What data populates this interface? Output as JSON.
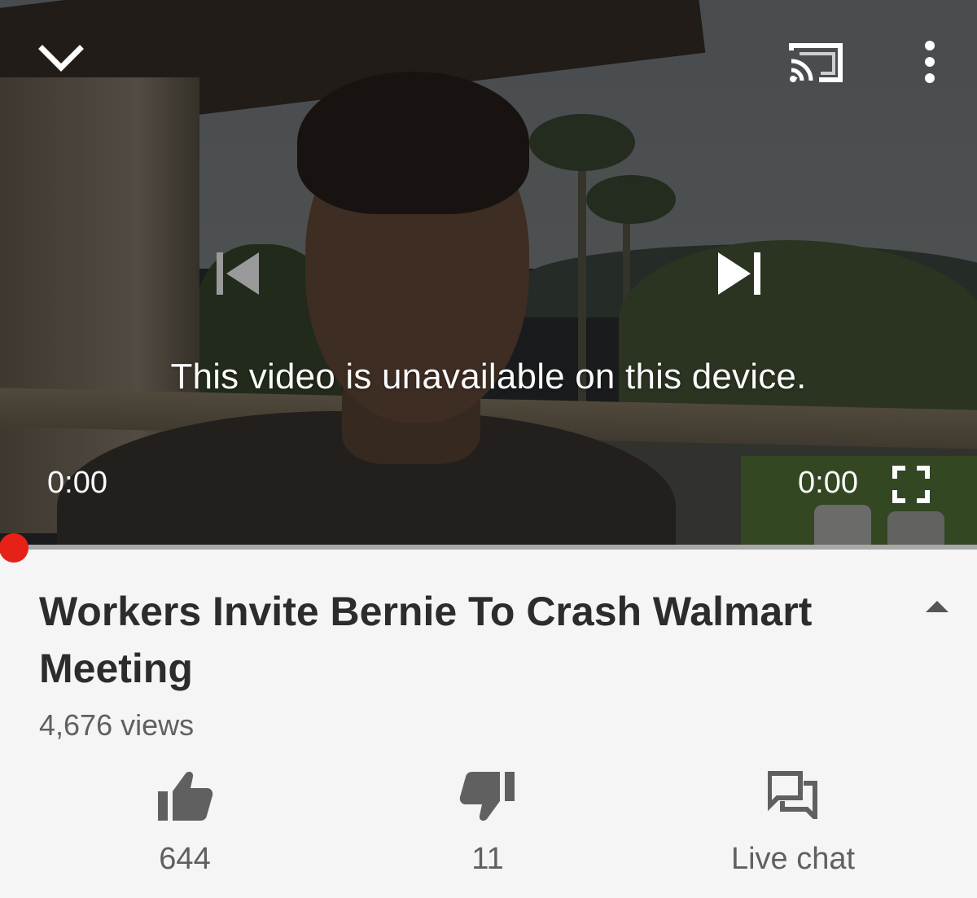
{
  "player": {
    "message": "This video is unavailable on this device.",
    "current_time": "0:00",
    "duration": "0:00",
    "progress": 0,
    "accent_color": "#e62117",
    "icons": {
      "collapse": "chevron-down-icon",
      "cast": "cast-icon",
      "more": "more-vert-icon",
      "previous": "skip-previous-icon",
      "next": "skip-next-icon",
      "fullscreen": "fullscreen-icon"
    }
  },
  "video": {
    "title": "Workers Invite Bernie To Crash Walmart Meeting",
    "views": "4,676 views"
  },
  "actions": {
    "like": {
      "icon": "thumb-up-icon",
      "label": "644"
    },
    "dislike": {
      "icon": "thumb-down-icon",
      "label": "11"
    },
    "live_chat": {
      "icon": "chat-icon",
      "label": "Live chat"
    }
  },
  "colors": {
    "panel_bg": "#f5f5f5",
    "title_text": "#2c2c2c",
    "secondary_text": "#606060",
    "icon_gray": "#606060"
  }
}
